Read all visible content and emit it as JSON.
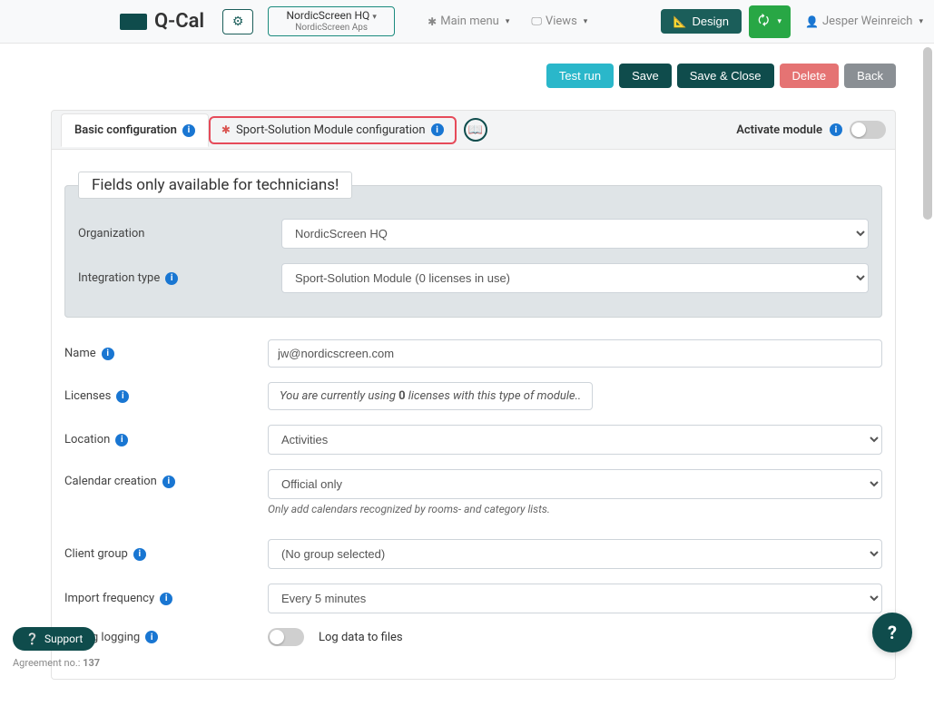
{
  "brand": "Q-Cal",
  "org": {
    "primary": "NordicScreen HQ",
    "secondary": "NordicScreen Aps"
  },
  "nav": {
    "mainMenu": "Main menu",
    "views": "Views",
    "design": "Design",
    "user": "Jesper Weinreich"
  },
  "actions": {
    "testRun": "Test run",
    "save": "Save",
    "saveClose": "Save & Close",
    "delete": "Delete",
    "back": "Back"
  },
  "tabs": {
    "basic": "Basic configuration",
    "module": "Sport-Solution Module configuration",
    "activate": "Activate module"
  },
  "fieldset": {
    "legend": "Fields only available for technicians!"
  },
  "fields": {
    "organization": {
      "label": "Organization",
      "value": "NordicScreen HQ"
    },
    "integrationType": {
      "label": "Integration type",
      "value": "Sport-Solution Module (0 licenses in use)"
    },
    "name": {
      "label": "Name",
      "value": "jw@nordicscreen.com"
    },
    "licenses": {
      "label": "Licenses",
      "prefix": "You are currently using ",
      "count": "0",
      "suffix": " licenses with this type of module.."
    },
    "location": {
      "label": "Location",
      "value": "Activities"
    },
    "calendarCreation": {
      "label": "Calendar creation",
      "value": "Official only",
      "helper": "Only add calendars recognized by rooms- and category lists."
    },
    "clientGroup": {
      "label": "Client group",
      "value": "(No group selected)"
    },
    "importFrequency": {
      "label": "Import frequency",
      "value": "Every 5 minutes"
    },
    "debugLogging": {
      "label": "Debug logging",
      "toggleText": "Log data to files"
    }
  },
  "footer": {
    "support": "Support",
    "agreementLabel": "Agreement no.: ",
    "agreementNo": "137"
  }
}
